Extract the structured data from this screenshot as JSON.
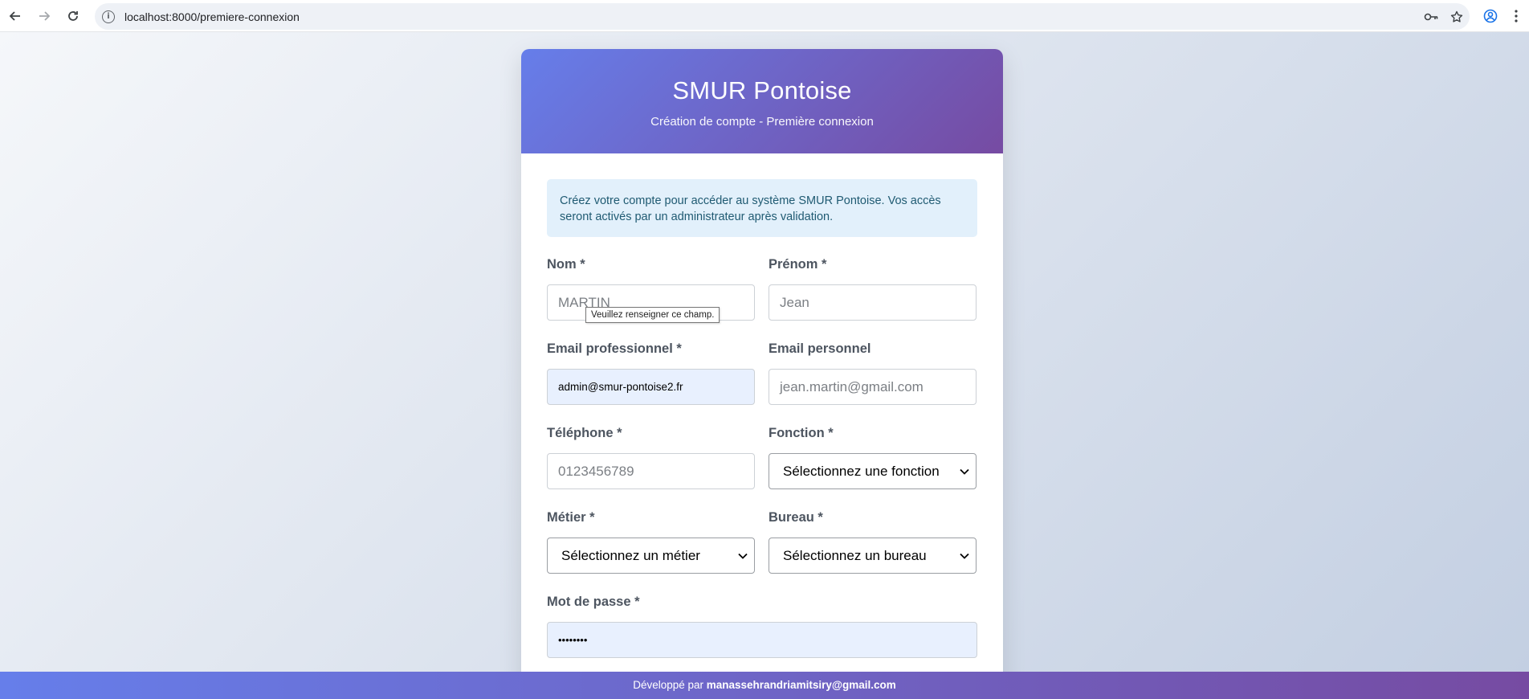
{
  "browser": {
    "url": "localhost:8000/premiere-connexion",
    "back_icon": "arrow-left",
    "forward_icon": "arrow-right",
    "reload_icon": "reload",
    "info_icon": "i",
    "key_icon": "key",
    "star_icon": "star",
    "profile_icon": "profile",
    "menu_icon": "kebab-menu"
  },
  "header": {
    "title": "SMUR Pontoise",
    "subtitle": "Création de compte - Première connexion"
  },
  "alert": {
    "text": "Créez votre compte pour accéder au système SMUR Pontoise. Vos accès seront activés par un administrateur après validation."
  },
  "form": {
    "nom": {
      "label": "Nom *",
      "placeholder": "MARTIN",
      "tooltip": "Veuillez renseigner ce champ."
    },
    "prenom": {
      "label": "Prénom *",
      "placeholder": "Jean"
    },
    "email_pro": {
      "label": "Email professionnel *",
      "value": "admin@smur-pontoise2.fr"
    },
    "email_perso": {
      "label": "Email personnel",
      "placeholder": "jean.martin@gmail.com"
    },
    "telephone": {
      "label": "Téléphone *",
      "placeholder": "0123456789"
    },
    "fonction": {
      "label": "Fonction *",
      "selected": "Sélectionnez une fonction"
    },
    "metier": {
      "label": "Métier *",
      "selected": "Sélectionnez un métier"
    },
    "bureau": {
      "label": "Bureau *",
      "selected": "Sélectionnez un bureau"
    },
    "password": {
      "label": "Mot de passe *",
      "value": "••••••••"
    }
  },
  "footer": {
    "prefix": "Développé par",
    "author": "manassehrandriamitsiry@gmail.com"
  },
  "colors": {
    "gradient_start": "#667eea",
    "gradient_end": "#764ba2",
    "alert_bg": "#e2f0fb",
    "autofill_bg": "#e8f0fe"
  }
}
